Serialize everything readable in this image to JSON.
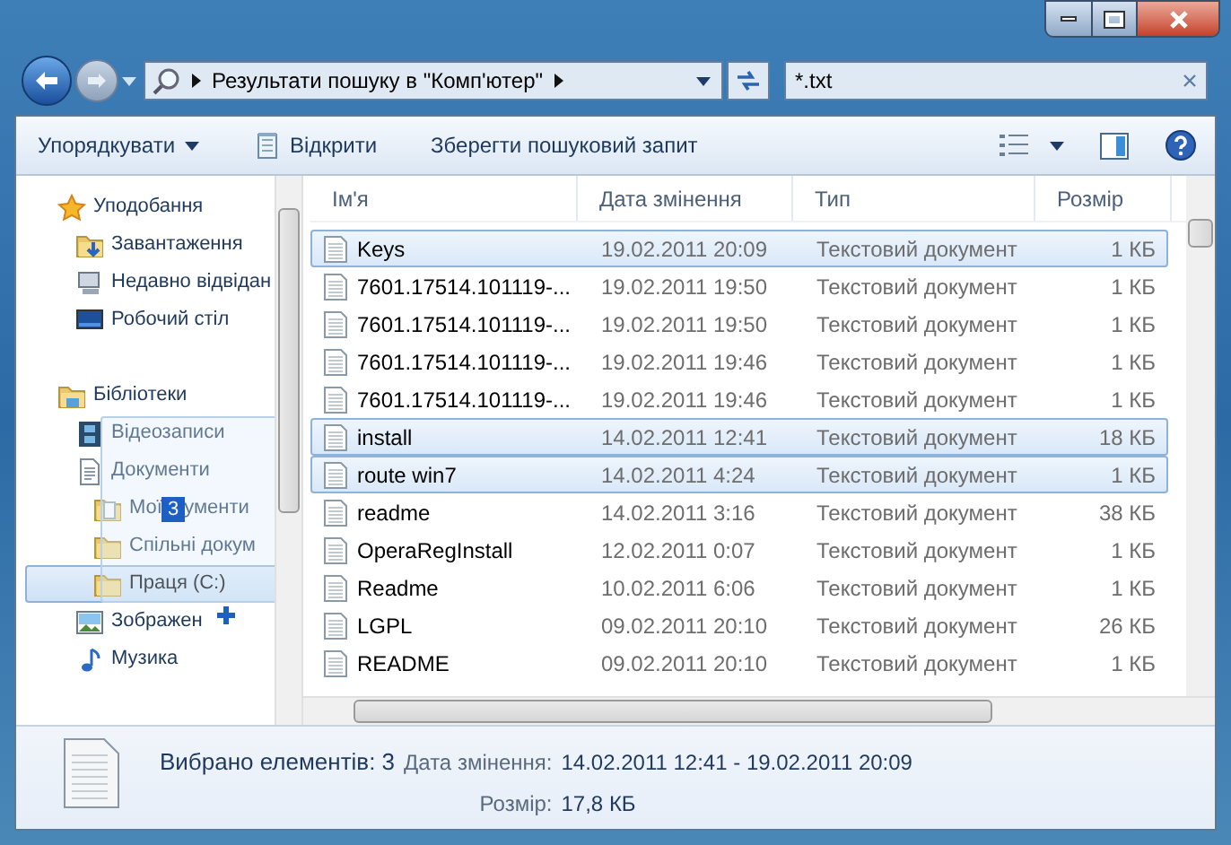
{
  "address": {
    "segments": [
      "Результати пошуку в \"Комп'ютер\""
    ]
  },
  "search": {
    "value": "*.txt"
  },
  "toolbar": {
    "items": [
      {
        "label": "Упорядкувати",
        "kind": "menu"
      },
      {
        "label": "Відкрити",
        "kind": "open"
      },
      {
        "label": "Зберегти пошуковий запит",
        "kind": "plain"
      }
    ]
  },
  "nav": {
    "groups": [
      {
        "label": "Уподобання",
        "kind": "star",
        "selected": false,
        "children": [
          {
            "label": "Завантаження",
            "kind": "download",
            "selected": false
          },
          {
            "label": "Недавно відвідан",
            "kind": "recent",
            "selected": false
          },
          {
            "label": "Робочий стіл",
            "kind": "desktop",
            "selected": false
          }
        ]
      },
      {
        "label": "Бібліотеки",
        "kind": "library",
        "selected": false,
        "children": [
          {
            "label": "Відеозаписи",
            "kind": "video",
            "selected": false
          },
          {
            "label": "Документи",
            "kind": "docs",
            "selected": false,
            "children": [
              {
                "label": "Мої",
                "label_rest": "ументи",
                "drag_badge": "3",
                "kind": "docfolder",
                "selected": false
              },
              {
                "label": "Спільні докум",
                "kind": "folder",
                "selected": false
              },
              {
                "label": "Праця (C:)",
                "kind": "folder",
                "selected": true
              }
            ]
          },
          {
            "label": "Зображен",
            "kind": "pictures",
            "selected": false
          },
          {
            "label": "Музика",
            "kind": "music",
            "selected": false
          }
        ]
      }
    ]
  },
  "table": {
    "columns": [
      "Ім'я",
      "Дата змінення",
      "Тип",
      "Розмір"
    ],
    "rows": [
      {
        "name": "Keys",
        "date": "19.02.2011 20:09",
        "type": "Текстовий документ",
        "size": "1 КБ",
        "selected": true
      },
      {
        "name": "7601.17514.101119-...",
        "date": "19.02.2011 19:50",
        "type": "Текстовий документ",
        "size": "1 КБ",
        "selected": false
      },
      {
        "name": "7601.17514.101119-...",
        "date": "19.02.2011 19:50",
        "type": "Текстовий документ",
        "size": "1 КБ",
        "selected": false
      },
      {
        "name": "7601.17514.101119-...",
        "date": "19.02.2011 19:46",
        "type": "Текстовий документ",
        "size": "1 КБ",
        "selected": false
      },
      {
        "name": "7601.17514.101119-...",
        "date": "19.02.2011 19:46",
        "type": "Текстовий документ",
        "size": "1 КБ",
        "selected": false
      },
      {
        "name": "install",
        "date": "14.02.2011 12:41",
        "type": "Текстовий документ",
        "size": "18 КБ",
        "selected": true
      },
      {
        "name": "route win7",
        "date": "14.02.2011 4:24",
        "type": "Текстовий документ",
        "size": "1 КБ",
        "selected": true
      },
      {
        "name": "readme",
        "date": "14.02.2011 3:16",
        "type": "Текстовий документ",
        "size": "38 КБ",
        "selected": false
      },
      {
        "name": "OperaRegInstall",
        "date": "12.02.2011 0:07",
        "type": "Текстовий документ",
        "size": "1 КБ",
        "selected": false
      },
      {
        "name": "Readme",
        "date": "10.02.2011 6:06",
        "type": "Текстовий документ",
        "size": "1 КБ",
        "selected": false
      },
      {
        "name": "LGPL",
        "date": "09.02.2011 20:10",
        "type": "Текстовий документ",
        "size": "26 КБ",
        "selected": false
      },
      {
        "name": "README",
        "date": "09.02.2011 20:10",
        "type": "Текстовий документ",
        "size": "1 КБ",
        "selected": false
      }
    ]
  },
  "details": {
    "summary": "Вибрано елементів: 3",
    "date_label": "Дата змінення:",
    "date_value": "14.02.2011 12:41 - 19.02.2011 20:09",
    "size_label": "Розмір:",
    "size_value": "17,8 КБ"
  }
}
